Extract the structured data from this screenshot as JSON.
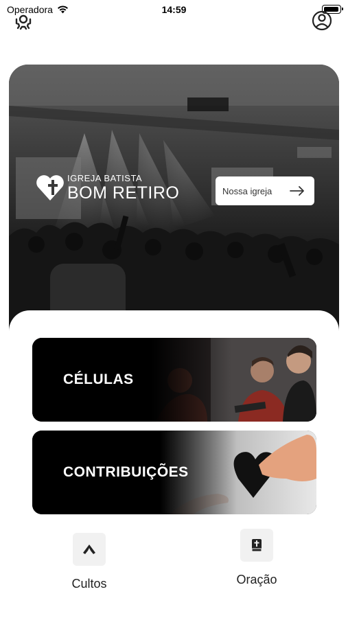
{
  "status_bar": {
    "carrier": "Operadora",
    "time": "14:59"
  },
  "header": {
    "left_icon": "settings-gear-icon",
    "right_icon": "user-profile-icon"
  },
  "hero": {
    "logo_line1": "IGREJA BATISTA",
    "logo_line2": "BOM RETIRO",
    "cta_label": "Nossa igreja",
    "cta_icon": "arrow-right-icon"
  },
  "cards": [
    {
      "label": "CÉLULAS"
    },
    {
      "label": "CONTRIBUIÇÕES"
    }
  ],
  "actions": [
    {
      "label": "Cultos",
      "icon": "praying-hands-icon"
    },
    {
      "label": "Oração",
      "icon": "bible-book-icon"
    }
  ],
  "colors": {
    "card_bg": "#000000",
    "hero_dark": "#2b2b2b",
    "action_box": "#f1f1f1"
  }
}
